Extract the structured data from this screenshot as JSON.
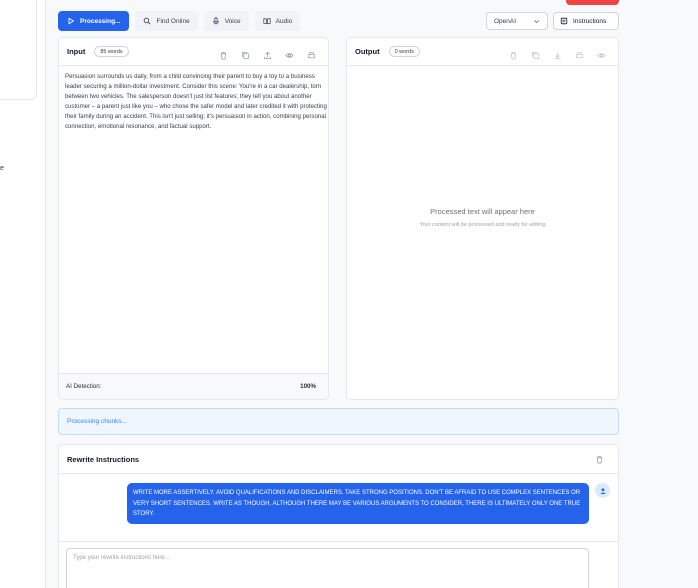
{
  "sidebar": {
    "fragment_text": "e"
  },
  "toolbar": {
    "processing_label": "Processing...",
    "find_online_label": "Find Online",
    "voice_label": "Voice",
    "audio_label": "Audio"
  },
  "provider": {
    "selected": "OpenAI"
  },
  "instructions_button_label": "Instructions",
  "input_panel": {
    "title": "Input",
    "word_count": "85 words",
    "text": "Persuasion surrounds us daily, from a child convincing their parent to buy a toy to a business leader securing a million-dollar investment. Consider this scene: You're in a car dealership, torn between two vehicles. The salesperson doesn't just list features; they tell you about another customer – a parent just like you – who chose the safer model and later credited it with protecting their family during an accident. This isn't just selling; it's persuasion in action, combining personal connection, emotional resonance, and factual support.",
    "ai_detection_label": "AI Detection:",
    "ai_detection_value": "100%"
  },
  "output_panel": {
    "title": "Output",
    "word_count": "0 words",
    "placeholder_title": "Processed text will appear here",
    "placeholder_subtitle": "Your content will be processed and ready for editing"
  },
  "status": {
    "text": "Processing chunks..."
  },
  "rewrite": {
    "title": "Rewrite Instructions",
    "message": "WRITE MORE ASSERTIVELY. AVOID QUALIFICATIONS AND DISCLAIMERS. TAKE STRONG POSITIONS. DON'T BE AFRAID TO USE COMPLEX SENTENCES OR VERY SHORT SENTENCES. WRITE AS THOUGH, ALTHOUGH THERE MAY BE VARIOUS ARGUMENTS TO CONSIDER, THERE IS ULTIMATELY ONLY ONE TRUE STORY.",
    "input_placeholder": "Type your rewrite instructions here..."
  },
  "colors": {
    "primary": "#2563eb",
    "danger": "#ef4444",
    "status_bg": "#eff6ff"
  }
}
